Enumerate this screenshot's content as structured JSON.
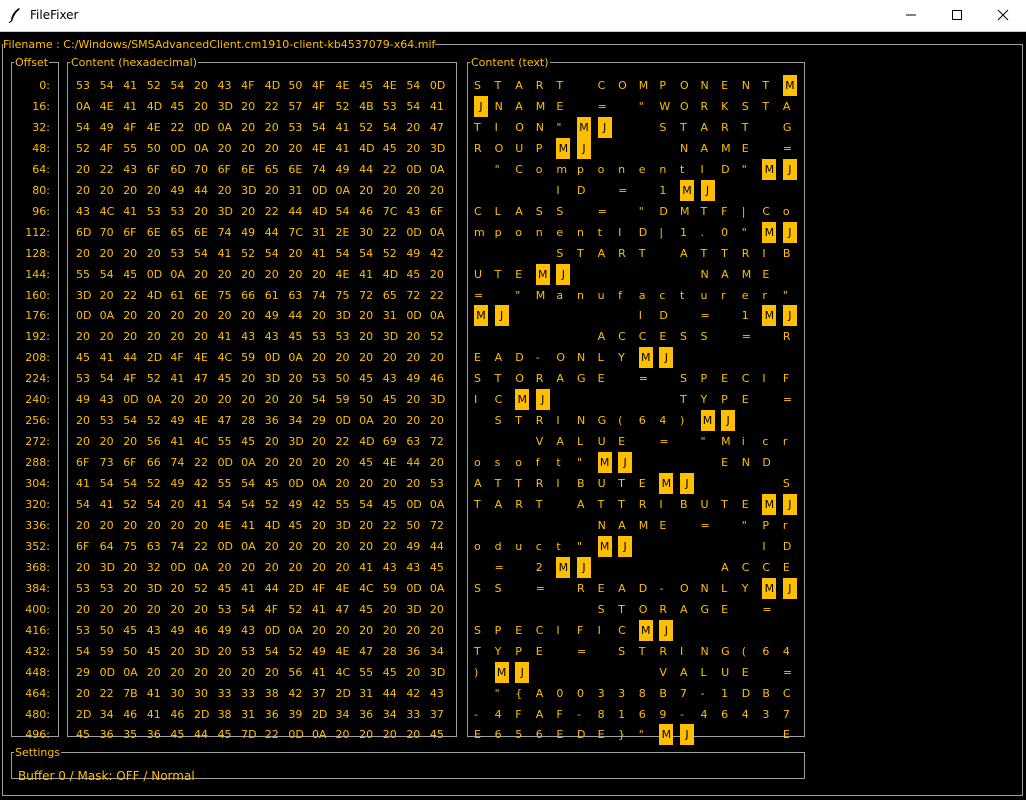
{
  "window": {
    "title": "FileFixer",
    "minimize_label": "—",
    "maximize_label": "☐",
    "close_label": "✕",
    "icon": "feather-icon"
  },
  "file": {
    "label": "Filename : C:/Windows/SMSAdvancedClient.cm1910-client-kb4537079-x64.mif"
  },
  "panels": {
    "offset_label": "Offset",
    "hex_label": "Content (hexadecimal)",
    "text_label": "Content (text)",
    "settings_label": "Settings"
  },
  "settings": {
    "status": "Buffer 0 / Mask: OFF / Normal"
  },
  "colors": {
    "accent": "#ffbf00",
    "background": "#000000",
    "border": "#a0a0a0"
  },
  "rows": [
    {
      "offset": "0:",
      "hex": [
        "53",
        "54",
        "41",
        "52",
        "54",
        "20",
        "43",
        "4F",
        "4D",
        "50",
        "4F",
        "4E",
        "45",
        "4E",
        "54",
        "0D"
      ],
      "text": [
        "S",
        "T",
        "A",
        "R",
        "T",
        " ",
        "C",
        "O",
        "M",
        "P",
        "O",
        "N",
        "E",
        "N",
        "T",
        "M"
      ]
    },
    {
      "offset": "16:",
      "hex": [
        "0A",
        "4E",
        "41",
        "4D",
        "45",
        "20",
        "3D",
        "20",
        "22",
        "57",
        "4F",
        "52",
        "4B",
        "53",
        "54",
        "41"
      ],
      "text": [
        "J",
        "N",
        "A",
        "M",
        "E",
        " ",
        "=",
        " ",
        "\"",
        "W",
        "O",
        "R",
        "K",
        "S",
        "T",
        "A"
      ]
    },
    {
      "offset": "32:",
      "hex": [
        "54",
        "49",
        "4F",
        "4E",
        "22",
        "0D",
        "0A",
        "20",
        "20",
        "53",
        "54",
        "41",
        "52",
        "54",
        "20",
        "47"
      ],
      "text": [
        "T",
        "I",
        "O",
        "N",
        "\"",
        "M",
        "J",
        " ",
        " ",
        "S",
        "T",
        "A",
        "R",
        "T",
        " ",
        "G"
      ]
    },
    {
      "offset": "48:",
      "hex": [
        "52",
        "4F",
        "55",
        "50",
        "0D",
        "0A",
        "20",
        "20",
        "20",
        "20",
        "4E",
        "41",
        "4D",
        "45",
        "20",
        "3D"
      ],
      "text": [
        "R",
        "O",
        "U",
        "P",
        "M",
        "J",
        " ",
        " ",
        " ",
        " ",
        "N",
        "A",
        "M",
        "E",
        " ",
        "="
      ]
    },
    {
      "offset": "64:",
      "hex": [
        "20",
        "22",
        "43",
        "6F",
        "6D",
        "70",
        "6F",
        "6E",
        "65",
        "6E",
        "74",
        "49",
        "44",
        "22",
        "0D",
        "0A"
      ],
      "text": [
        " ",
        "\"",
        "C",
        "o",
        "m",
        "p",
        "o",
        "n",
        "e",
        "n",
        "t",
        "I",
        "D",
        "\"",
        "M",
        "J"
      ]
    },
    {
      "offset": "80:",
      "hex": [
        "20",
        "20",
        "20",
        "20",
        "49",
        "44",
        "20",
        "3D",
        "20",
        "31",
        "0D",
        "0A",
        "20",
        "20",
        "20",
        "20"
      ],
      "text": [
        " ",
        " ",
        " ",
        " ",
        "I",
        "D",
        " ",
        "=",
        " ",
        "1",
        "M",
        "J",
        " ",
        " ",
        " ",
        " "
      ]
    },
    {
      "offset": "96:",
      "hex": [
        "43",
        "4C",
        "41",
        "53",
        "53",
        "20",
        "3D",
        "20",
        "22",
        "44",
        "4D",
        "54",
        "46",
        "7C",
        "43",
        "6F"
      ],
      "text": [
        "C",
        "L",
        "A",
        "S",
        "S",
        " ",
        "=",
        " ",
        "\"",
        "D",
        "M",
        "T",
        "F",
        "|",
        "C",
        "o"
      ]
    },
    {
      "offset": "112:",
      "hex": [
        "6D",
        "70",
        "6F",
        "6E",
        "65",
        "6E",
        "74",
        "49",
        "44",
        "7C",
        "31",
        "2E",
        "30",
        "22",
        "0D",
        "0A"
      ],
      "text": [
        "m",
        "p",
        "o",
        "n",
        "e",
        "n",
        "t",
        "I",
        "D",
        "|",
        "1",
        ".",
        "0",
        "\"",
        "M",
        "J"
      ]
    },
    {
      "offset": "128:",
      "hex": [
        "20",
        "20",
        "20",
        "20",
        "53",
        "54",
        "41",
        "52",
        "54",
        "20",
        "41",
        "54",
        "54",
        "52",
        "49",
        "42"
      ],
      "text": [
        " ",
        " ",
        " ",
        " ",
        "S",
        "T",
        "A",
        "R",
        "T",
        " ",
        "A",
        "T",
        "T",
        "R",
        "I",
        "B"
      ]
    },
    {
      "offset": "144:",
      "hex": [
        "55",
        "54",
        "45",
        "0D",
        "0A",
        "20",
        "20",
        "20",
        "20",
        "20",
        "20",
        "4E",
        "41",
        "4D",
        "45",
        "20"
      ],
      "text": [
        "U",
        "T",
        "E",
        "M",
        "J",
        " ",
        " ",
        " ",
        " ",
        " ",
        " ",
        "N",
        "A",
        "M",
        "E",
        " "
      ]
    },
    {
      "offset": "160:",
      "hex": [
        "3D",
        "20",
        "22",
        "4D",
        "61",
        "6E",
        "75",
        "66",
        "61",
        "63",
        "74",
        "75",
        "72",
        "65",
        "72",
        "22"
      ],
      "text": [
        "=",
        " ",
        "\"",
        "M",
        "a",
        "n",
        "u",
        "f",
        "a",
        "c",
        "t",
        "u",
        "r",
        "e",
        "r",
        "\""
      ]
    },
    {
      "offset": "176:",
      "hex": [
        "0D",
        "0A",
        "20",
        "20",
        "20",
        "20",
        "20",
        "20",
        "49",
        "44",
        "20",
        "3D",
        "20",
        "31",
        "0D",
        "0A"
      ],
      "text": [
        "M",
        "J",
        " ",
        " ",
        " ",
        " ",
        " ",
        " ",
        "I",
        "D",
        " ",
        "=",
        " ",
        "1",
        "M",
        "J"
      ]
    },
    {
      "offset": "192:",
      "hex": [
        "20",
        "20",
        "20",
        "20",
        "20",
        "20",
        "41",
        "43",
        "43",
        "45",
        "53",
        "53",
        "20",
        "3D",
        "20",
        "52"
      ],
      "text": [
        " ",
        " ",
        " ",
        " ",
        " ",
        " ",
        "A",
        "C",
        "C",
        "E",
        "S",
        "S",
        " ",
        "=",
        " ",
        "R"
      ]
    },
    {
      "offset": "208:",
      "hex": [
        "45",
        "41",
        "44",
        "2D",
        "4F",
        "4E",
        "4C",
        "59",
        "0D",
        "0A",
        "20",
        "20",
        "20",
        "20",
        "20",
        "20"
      ],
      "text": [
        "E",
        "A",
        "D",
        "-",
        "O",
        "N",
        "L",
        "Y",
        "M",
        "J",
        " ",
        " ",
        " ",
        " ",
        " ",
        " "
      ]
    },
    {
      "offset": "224:",
      "hex": [
        "53",
        "54",
        "4F",
        "52",
        "41",
        "47",
        "45",
        "20",
        "3D",
        "20",
        "53",
        "50",
        "45",
        "43",
        "49",
        "46"
      ],
      "text": [
        "S",
        "T",
        "O",
        "R",
        "A",
        "G",
        "E",
        " ",
        "=",
        " ",
        "S",
        "P",
        "E",
        "C",
        "I",
        "F"
      ]
    },
    {
      "offset": "240:",
      "hex": [
        "49",
        "43",
        "0D",
        "0A",
        "20",
        "20",
        "20",
        "20",
        "20",
        "20",
        "54",
        "59",
        "50",
        "45",
        "20",
        "3D"
      ],
      "text": [
        "I",
        "C",
        "M",
        "J",
        " ",
        " ",
        " ",
        " ",
        " ",
        " ",
        "T",
        "Y",
        "P",
        "E",
        " ",
        "="
      ]
    },
    {
      "offset": "256:",
      "hex": [
        "20",
        "53",
        "54",
        "52",
        "49",
        "4E",
        "47",
        "28",
        "36",
        "34",
        "29",
        "0D",
        "0A",
        "20",
        "20",
        "20"
      ],
      "text": [
        " ",
        "S",
        "T",
        "R",
        "I",
        "N",
        "G",
        "(",
        "6",
        "4",
        ")",
        "M",
        "J",
        " ",
        " ",
        " "
      ]
    },
    {
      "offset": "272:",
      "hex": [
        "20",
        "20",
        "20",
        "56",
        "41",
        "4C",
        "55",
        "45",
        "20",
        "3D",
        "20",
        "22",
        "4D",
        "69",
        "63",
        "72"
      ],
      "text": [
        " ",
        " ",
        " ",
        "V",
        "A",
        "L",
        "U",
        "E",
        " ",
        "=",
        " ",
        "\"",
        "M",
        "i",
        "c",
        "r"
      ]
    },
    {
      "offset": "288:",
      "hex": [
        "6F",
        "73",
        "6F",
        "66",
        "74",
        "22",
        "0D",
        "0A",
        "20",
        "20",
        "20",
        "20",
        "45",
        "4E",
        "44",
        "20"
      ],
      "text": [
        "o",
        "s",
        "o",
        "f",
        "t",
        "\"",
        "M",
        "J",
        " ",
        " ",
        " ",
        " ",
        "E",
        "N",
        "D",
        " "
      ]
    },
    {
      "offset": "304:",
      "hex": [
        "41",
        "54",
        "54",
        "52",
        "49",
        "42",
        "55",
        "54",
        "45",
        "0D",
        "0A",
        "20",
        "20",
        "20",
        "20",
        "53"
      ],
      "text": [
        "A",
        "T",
        "T",
        "R",
        "I",
        "B",
        "U",
        "T",
        "E",
        "M",
        "J",
        " ",
        " ",
        " ",
        " ",
        "S"
      ]
    },
    {
      "offset": "320:",
      "hex": [
        "54",
        "41",
        "52",
        "54",
        "20",
        "41",
        "54",
        "54",
        "52",
        "49",
        "42",
        "55",
        "54",
        "45",
        "0D",
        "0A"
      ],
      "text": [
        "T",
        "A",
        "R",
        "T",
        " ",
        "A",
        "T",
        "T",
        "R",
        "I",
        "B",
        "U",
        "T",
        "E",
        "M",
        "J"
      ]
    },
    {
      "offset": "336:",
      "hex": [
        "20",
        "20",
        "20",
        "20",
        "20",
        "20",
        "4E",
        "41",
        "4D",
        "45",
        "20",
        "3D",
        "20",
        "22",
        "50",
        "72"
      ],
      "text": [
        " ",
        " ",
        " ",
        " ",
        " ",
        " ",
        "N",
        "A",
        "M",
        "E",
        " ",
        "=",
        " ",
        "\"",
        "P",
        "r"
      ]
    },
    {
      "offset": "352:",
      "hex": [
        "6F",
        "64",
        "75",
        "63",
        "74",
        "22",
        "0D",
        "0A",
        "20",
        "20",
        "20",
        "20",
        "20",
        "20",
        "49",
        "44"
      ],
      "text": [
        "o",
        "d",
        "u",
        "c",
        "t",
        "\"",
        "M",
        "J",
        " ",
        " ",
        " ",
        " ",
        " ",
        " ",
        "I",
        "D"
      ]
    },
    {
      "offset": "368:",
      "hex": [
        "20",
        "3D",
        "20",
        "32",
        "0D",
        "0A",
        "20",
        "20",
        "20",
        "20",
        "20",
        "20",
        "41",
        "43",
        "43",
        "45"
      ],
      "text": [
        " ",
        "=",
        " ",
        "2",
        "M",
        "J",
        " ",
        " ",
        " ",
        " ",
        " ",
        " ",
        "A",
        "C",
        "C",
        "E"
      ]
    },
    {
      "offset": "384:",
      "hex": [
        "53",
        "53",
        "20",
        "3D",
        "20",
        "52",
        "45",
        "41",
        "44",
        "2D",
        "4F",
        "4E",
        "4C",
        "59",
        "0D",
        "0A"
      ],
      "text": [
        "S",
        "S",
        " ",
        "=",
        " ",
        "R",
        "E",
        "A",
        "D",
        "-",
        "O",
        "N",
        "L",
        "Y",
        "M",
        "J"
      ]
    },
    {
      "offset": "400:",
      "hex": [
        "20",
        "20",
        "20",
        "20",
        "20",
        "20",
        "53",
        "54",
        "4F",
        "52",
        "41",
        "47",
        "45",
        "20",
        "3D",
        "20"
      ],
      "text": [
        " ",
        " ",
        " ",
        " ",
        " ",
        " ",
        "S",
        "T",
        "O",
        "R",
        "A",
        "G",
        "E",
        " ",
        "=",
        " "
      ]
    },
    {
      "offset": "416:",
      "hex": [
        "53",
        "50",
        "45",
        "43",
        "49",
        "46",
        "49",
        "43",
        "0D",
        "0A",
        "20",
        "20",
        "20",
        "20",
        "20",
        "20"
      ],
      "text": [
        "S",
        "P",
        "E",
        "C",
        "I",
        "F",
        "I",
        "C",
        "M",
        "J",
        " ",
        " ",
        " ",
        " ",
        " ",
        " "
      ]
    },
    {
      "offset": "432:",
      "hex": [
        "54",
        "59",
        "50",
        "45",
        "20",
        "3D",
        "20",
        "53",
        "54",
        "52",
        "49",
        "4E",
        "47",
        "28",
        "36",
        "34"
      ],
      "text": [
        "T",
        "Y",
        "P",
        "E",
        " ",
        "=",
        " ",
        "S",
        "T",
        "R",
        "I",
        "N",
        "G",
        "(",
        "6",
        "4"
      ]
    },
    {
      "offset": "448:",
      "hex": [
        "29",
        "0D",
        "0A",
        "20",
        "20",
        "20",
        "20",
        "20",
        "20",
        "56",
        "41",
        "4C",
        "55",
        "45",
        "20",
        "3D"
      ],
      "text": [
        ")",
        "M",
        "J",
        " ",
        " ",
        " ",
        " ",
        " ",
        " ",
        "V",
        "A",
        "L",
        "U",
        "E",
        " ",
        "="
      ]
    },
    {
      "offset": "464:",
      "hex": [
        "20",
        "22",
        "7B",
        "41",
        "30",
        "30",
        "33",
        "33",
        "38",
        "42",
        "37",
        "2D",
        "31",
        "44",
        "42",
        "43"
      ],
      "text": [
        " ",
        "\"",
        "{",
        "A",
        "0",
        "0",
        "3",
        "3",
        "8",
        "B",
        "7",
        "-",
        "1",
        "D",
        "B",
        "C"
      ]
    },
    {
      "offset": "480:",
      "hex": [
        "2D",
        "34",
        "46",
        "41",
        "46",
        "2D",
        "38",
        "31",
        "36",
        "39",
        "2D",
        "34",
        "36",
        "34",
        "33",
        "37"
      ],
      "text": [
        "-",
        "4",
        "F",
        "A",
        "F",
        "-",
        "8",
        "1",
        "6",
        "9",
        "-",
        "4",
        "6",
        "4",
        "3",
        "7"
      ]
    },
    {
      "offset": "496:",
      "hex": [
        "45",
        "36",
        "35",
        "36",
        "45",
        "44",
        "45",
        "7D",
        "22",
        "0D",
        "0A",
        "20",
        "20",
        "20",
        "20",
        "45"
      ],
      "text": [
        "E",
        "6",
        "5",
        "6",
        "E",
        "D",
        "E",
        "}",
        "\"",
        "M",
        "J",
        " ",
        " ",
        " ",
        " ",
        "E"
      ]
    }
  ]
}
